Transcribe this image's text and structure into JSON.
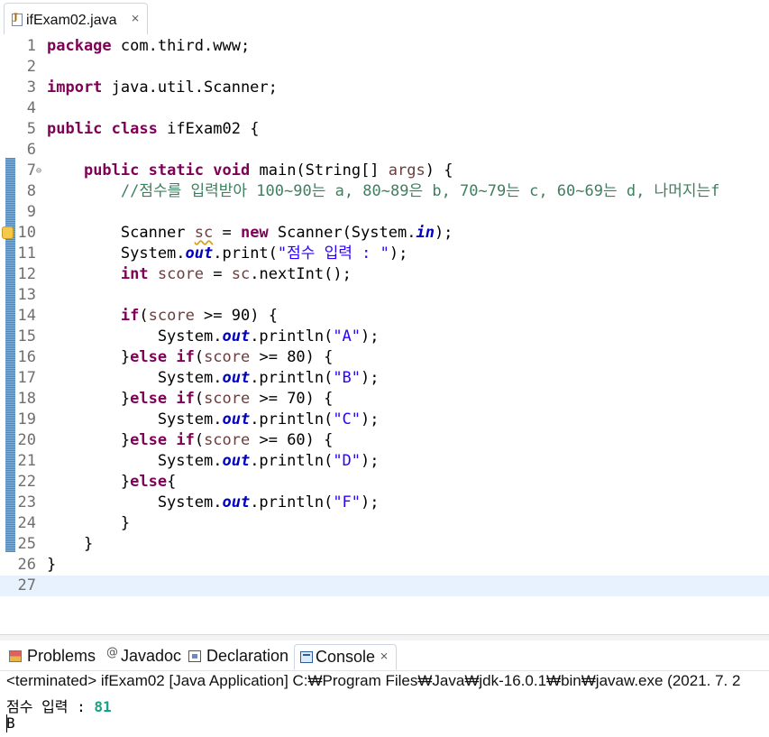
{
  "editor": {
    "tab": {
      "icon": "java-file-icon",
      "title": "ifExam02.java",
      "close": "⨯"
    },
    "lines": [
      {
        "n": "1",
        "tokens": [
          {
            "t": "package",
            "c": "kw"
          },
          {
            "t": " com.third.www;",
            "c": ""
          }
        ]
      },
      {
        "n": "2",
        "tokens": []
      },
      {
        "n": "3",
        "tokens": [
          {
            "t": "import",
            "c": "kw"
          },
          {
            "t": " java.util.Scanner;",
            "c": ""
          }
        ]
      },
      {
        "n": "4",
        "tokens": []
      },
      {
        "n": "5",
        "tokens": [
          {
            "t": "public",
            "c": "kw"
          },
          {
            "t": " ",
            "c": ""
          },
          {
            "t": "class",
            "c": "kw"
          },
          {
            "t": " ifExam02 {",
            "c": ""
          }
        ]
      },
      {
        "n": "6",
        "tokens": []
      },
      {
        "n": "7",
        "fold": true,
        "tokens": [
          {
            "t": "    ",
            "c": ""
          },
          {
            "t": "public",
            "c": "kw"
          },
          {
            "t": " ",
            "c": ""
          },
          {
            "t": "static",
            "c": "kw"
          },
          {
            "t": " ",
            "c": ""
          },
          {
            "t": "void",
            "c": "kw"
          },
          {
            "t": " main(String[] ",
            "c": ""
          },
          {
            "t": "args",
            "c": "var"
          },
          {
            "t": ") {",
            "c": ""
          }
        ]
      },
      {
        "n": "8",
        "tokens": [
          {
            "t": "        //점수를 입력받아 100~90는 a, 80~89은 b, 70~79는 c, 60~69는 d, 나머지는f",
            "c": "cm"
          }
        ]
      },
      {
        "n": "9",
        "tokens": []
      },
      {
        "n": "10",
        "warn": true,
        "tokens": [
          {
            "t": "        Scanner ",
            "c": ""
          },
          {
            "t": "sc",
            "c": "var-warn"
          },
          {
            "t": " = ",
            "c": ""
          },
          {
            "t": "new",
            "c": "kw"
          },
          {
            "t": " Scanner(System.",
            "c": ""
          },
          {
            "t": "in",
            "c": "fld"
          },
          {
            "t": ");",
            "c": ""
          }
        ]
      },
      {
        "n": "11",
        "tokens": [
          {
            "t": "        System.",
            "c": ""
          },
          {
            "t": "out",
            "c": "fld"
          },
          {
            "t": ".print(",
            "c": ""
          },
          {
            "t": "\"점수 입력 : \"",
            "c": "st"
          },
          {
            "t": ");",
            "c": ""
          }
        ]
      },
      {
        "n": "12",
        "tokens": [
          {
            "t": "        ",
            "c": ""
          },
          {
            "t": "int",
            "c": "kw"
          },
          {
            "t": " ",
            "c": ""
          },
          {
            "t": "score",
            "c": "var"
          },
          {
            "t": " = ",
            "c": ""
          },
          {
            "t": "sc",
            "c": "var"
          },
          {
            "t": ".nextInt();",
            "c": ""
          }
        ]
      },
      {
        "n": "13",
        "tokens": []
      },
      {
        "n": "14",
        "tokens": [
          {
            "t": "        ",
            "c": ""
          },
          {
            "t": "if",
            "c": "kw"
          },
          {
            "t": "(",
            "c": ""
          },
          {
            "t": "score",
            "c": "var"
          },
          {
            "t": " >= 90) {",
            "c": ""
          }
        ]
      },
      {
        "n": "15",
        "tokens": [
          {
            "t": "            System.",
            "c": ""
          },
          {
            "t": "out",
            "c": "fld"
          },
          {
            "t": ".println(",
            "c": ""
          },
          {
            "t": "\"A\"",
            "c": "st"
          },
          {
            "t": ");",
            "c": ""
          }
        ]
      },
      {
        "n": "16",
        "tokens": [
          {
            "t": "        }",
            "c": ""
          },
          {
            "t": "else",
            "c": "kw"
          },
          {
            "t": " ",
            "c": ""
          },
          {
            "t": "if",
            "c": "kw"
          },
          {
            "t": "(",
            "c": ""
          },
          {
            "t": "score",
            "c": "var"
          },
          {
            "t": " >= 80) {",
            "c": ""
          }
        ]
      },
      {
        "n": "17",
        "tokens": [
          {
            "t": "            System.",
            "c": ""
          },
          {
            "t": "out",
            "c": "fld"
          },
          {
            "t": ".println(",
            "c": ""
          },
          {
            "t": "\"B\"",
            "c": "st"
          },
          {
            "t": ");",
            "c": ""
          }
        ]
      },
      {
        "n": "18",
        "tokens": [
          {
            "t": "        }",
            "c": ""
          },
          {
            "t": "else",
            "c": "kw"
          },
          {
            "t": " ",
            "c": ""
          },
          {
            "t": "if",
            "c": "kw"
          },
          {
            "t": "(",
            "c": ""
          },
          {
            "t": "score",
            "c": "var"
          },
          {
            "t": " >= 70) {",
            "c": ""
          }
        ]
      },
      {
        "n": "19",
        "tokens": [
          {
            "t": "            System.",
            "c": ""
          },
          {
            "t": "out",
            "c": "fld"
          },
          {
            "t": ".println(",
            "c": ""
          },
          {
            "t": "\"C\"",
            "c": "st"
          },
          {
            "t": ");",
            "c": ""
          }
        ]
      },
      {
        "n": "20",
        "tokens": [
          {
            "t": "        }",
            "c": ""
          },
          {
            "t": "else",
            "c": "kw"
          },
          {
            "t": " ",
            "c": ""
          },
          {
            "t": "if",
            "c": "kw"
          },
          {
            "t": "(",
            "c": ""
          },
          {
            "t": "score",
            "c": "var"
          },
          {
            "t": " >= 60) {",
            "c": ""
          }
        ]
      },
      {
        "n": "21",
        "tokens": [
          {
            "t": "            System.",
            "c": ""
          },
          {
            "t": "out",
            "c": "fld"
          },
          {
            "t": ".println(",
            "c": ""
          },
          {
            "t": "\"D\"",
            "c": "st"
          },
          {
            "t": ");",
            "c": ""
          }
        ]
      },
      {
        "n": "22",
        "tokens": [
          {
            "t": "        }",
            "c": ""
          },
          {
            "t": "else",
            "c": "kw"
          },
          {
            "t": "{",
            "c": ""
          }
        ]
      },
      {
        "n": "23",
        "tokens": [
          {
            "t": "            System.",
            "c": ""
          },
          {
            "t": "out",
            "c": "fld"
          },
          {
            "t": ".println(",
            "c": ""
          },
          {
            "t": "\"F\"",
            "c": "st"
          },
          {
            "t": ");",
            "c": ""
          }
        ]
      },
      {
        "n": "24",
        "tokens": [
          {
            "t": "        }",
            "c": ""
          }
        ]
      },
      {
        "n": "25",
        "tokens": [
          {
            "t": "    }",
            "c": ""
          }
        ]
      },
      {
        "n": "26",
        "tokens": [
          {
            "t": "}",
            "c": ""
          }
        ]
      },
      {
        "n": "27",
        "current": true,
        "tokens": []
      }
    ],
    "scroll_left_glyph": "<"
  },
  "views": {
    "tabs": [
      {
        "id": "problems",
        "label": "Problems",
        "icon": "problems-icon",
        "active": false
      },
      {
        "id": "javadoc",
        "label": "Javadoc",
        "icon": "javadoc-icon",
        "active": false
      },
      {
        "id": "declaration",
        "label": "Declaration",
        "icon": "declaration-icon",
        "active": false
      },
      {
        "id": "console",
        "label": "Console",
        "icon": "console-icon",
        "active": true
      }
    ],
    "javadoc_glyph": "@",
    "close": "⨯"
  },
  "console": {
    "status": "<terminated> ifExam02 [Java Application] C:₩Program Files₩Java₩jdk-16.0.1₩bin₩javaw.exe  (2021. 7. 2",
    "prompt": "점수 입력 : ",
    "input": "81",
    "output": "B"
  },
  "colors": {
    "keyword": "#7f0055",
    "comment": "#3f7f5f",
    "string": "#2a00ff",
    "field": "#0000c0",
    "local_var": "#6a3e3e",
    "current_line": "#e8f2fe",
    "console_input": "#16a085"
  }
}
